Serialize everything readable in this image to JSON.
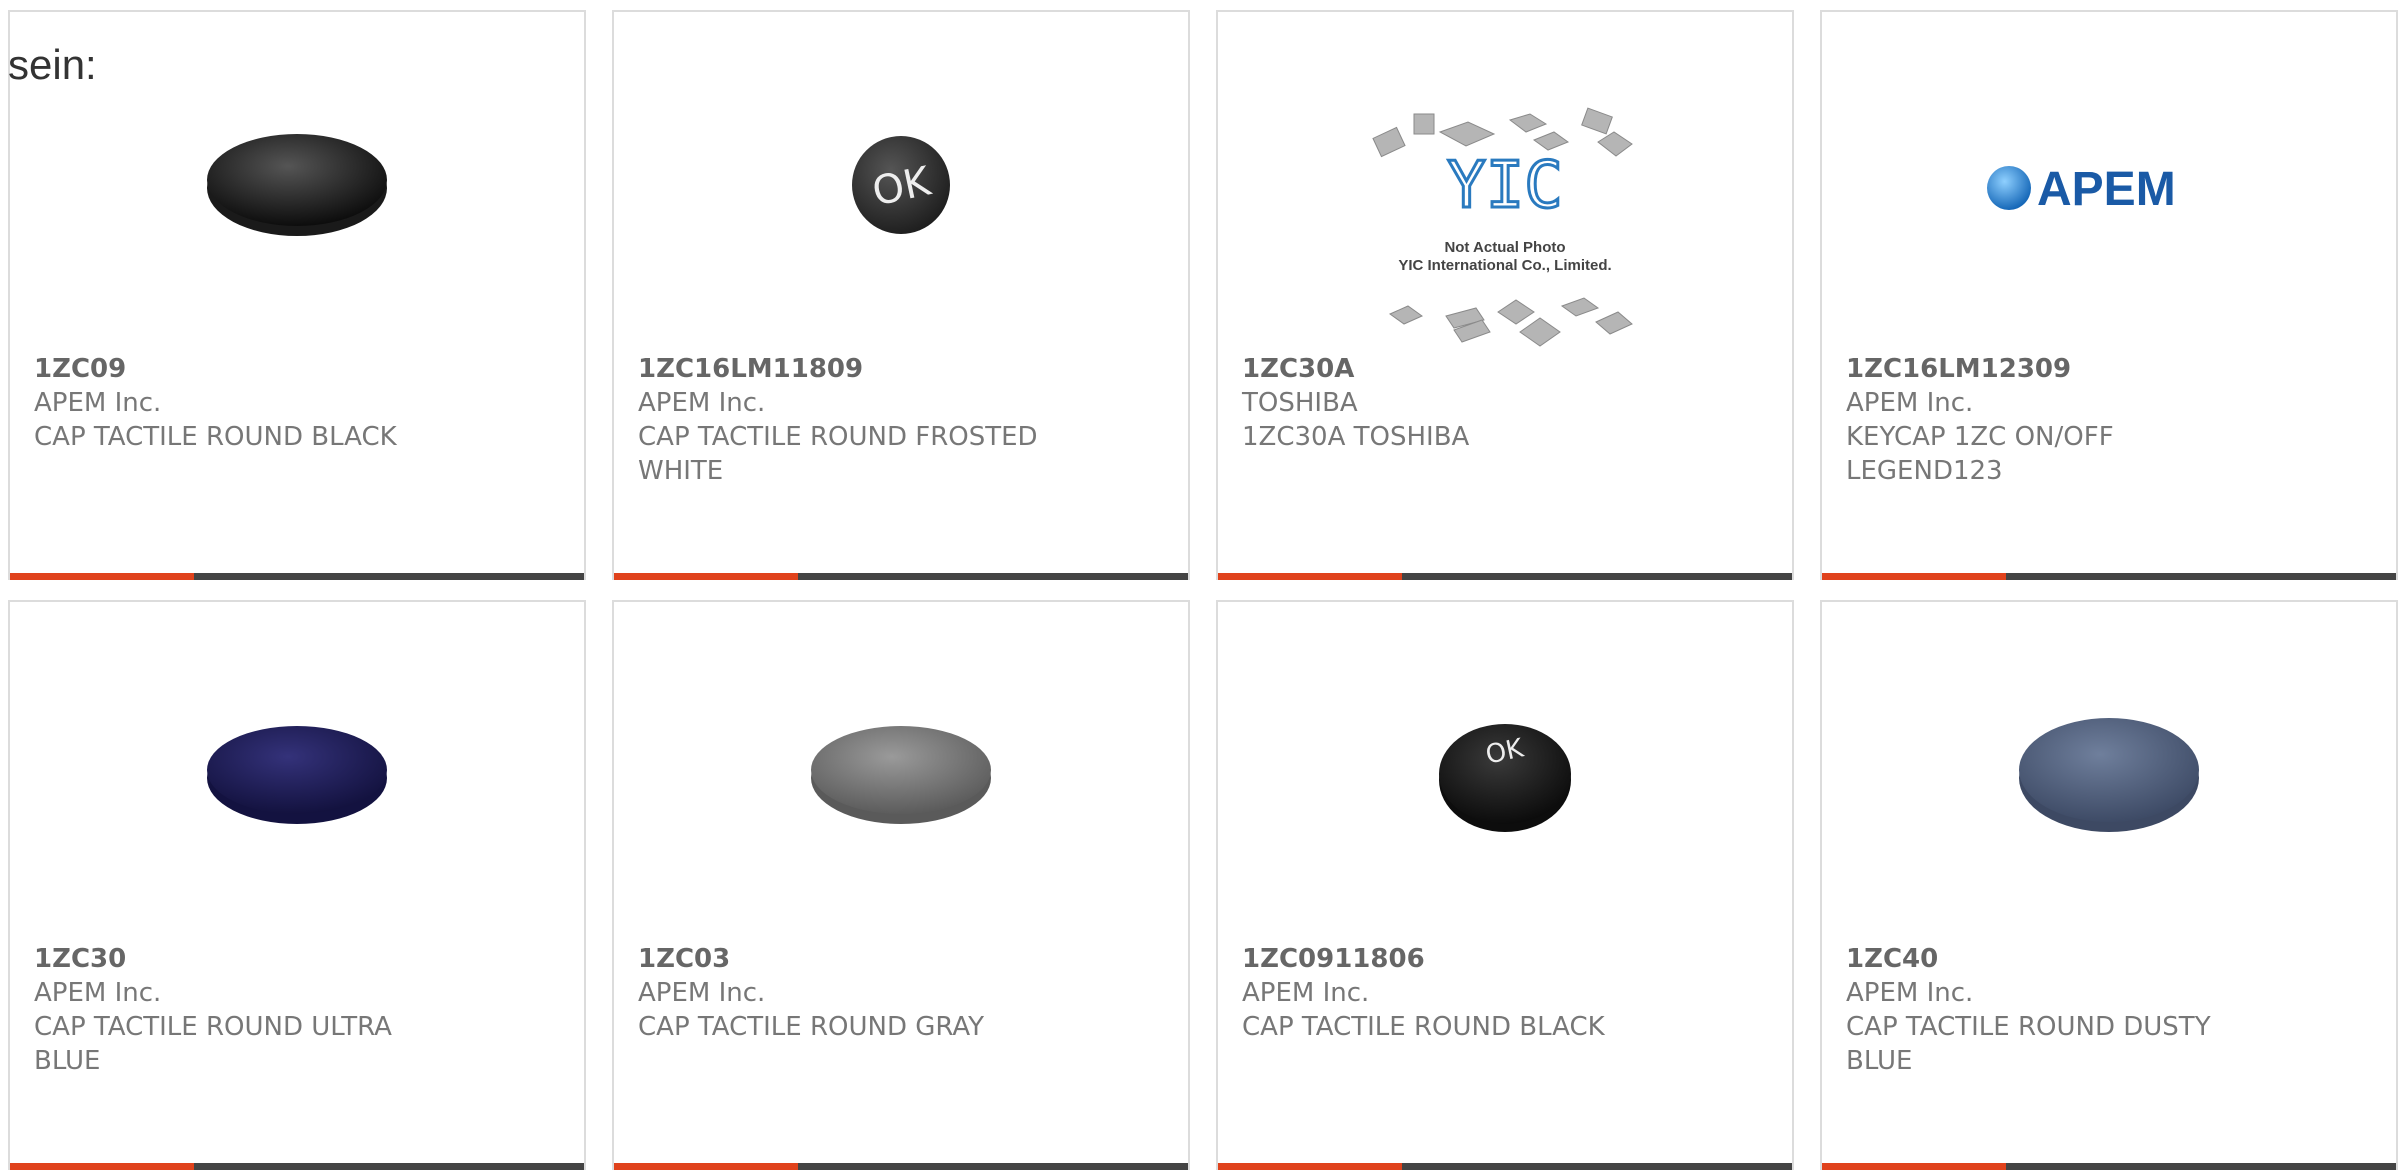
{
  "heading": "sein:",
  "colors": {
    "accent": "#e0421c",
    "bar": "#444444",
    "border": "#dcdcdc",
    "text": "#777777"
  },
  "products": [
    {
      "part_number": "1ZC09",
      "manufacturer": "APEM Inc.",
      "description": "CAP TACTILE ROUND BLACK",
      "image": "black-round-cap"
    },
    {
      "part_number": "1ZC16LM11809",
      "manufacturer": "APEM Inc.",
      "description": "CAP TACTILE ROUND FROSTED WHITE",
      "image": "ok-legend-cap",
      "legend": "OK"
    },
    {
      "part_number": "1ZC30A",
      "manufacturer": "TOSHIBA",
      "description": "1ZC30A TOSHIBA",
      "image": "placeholder-photo",
      "placeholder": {
        "logo": "YIC",
        "line1": "Not Actual Photo",
        "line2": "YIC International Co., Limited."
      }
    },
    {
      "part_number": "1ZC16LM12309",
      "manufacturer": "APEM Inc.",
      "description": "KEYCAP 1ZC ON/OFF LEGEND123",
      "image": "apem-logo",
      "logo_text": "APEM"
    },
    {
      "part_number": "1ZC30",
      "manufacturer": "APEM Inc.",
      "description": "CAP TACTILE ROUND ULTRA BLUE",
      "image": "ultra-blue-round-cap"
    },
    {
      "part_number": "1ZC03",
      "manufacturer": "APEM Inc.",
      "description": "CAP TACTILE ROUND GRAY",
      "image": "gray-round-cap"
    },
    {
      "part_number": "1ZC0911806",
      "manufacturer": "APEM Inc.",
      "description": "CAP TACTILE ROUND BLACK",
      "image": "ok-legend-cap",
      "legend": "OK"
    },
    {
      "part_number": "1ZC40",
      "manufacturer": "APEM Inc.",
      "description": "CAP TACTILE ROUND DUSTY BLUE",
      "image": "dusty-blue-round-cap"
    }
  ]
}
